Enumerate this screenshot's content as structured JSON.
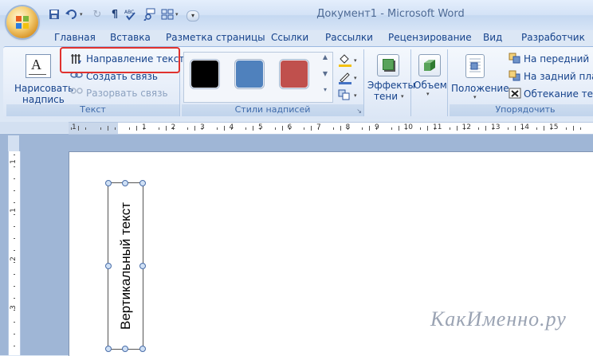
{
  "window": {
    "title": "Документ1 - Microsoft Word",
    "quick_access": [
      "save-icon",
      "undo-icon",
      "redo-icon",
      "pilcrow-icon",
      "spellcheck-icon",
      "zoom-icon",
      "layout-icon"
    ]
  },
  "tabs": [
    {
      "label": "Главная"
    },
    {
      "label": "Вставка"
    },
    {
      "label": "Разметка страницы"
    },
    {
      "label": "Ссылки"
    },
    {
      "label": "Рассылки"
    },
    {
      "label": "Рецензирование"
    },
    {
      "label": "Вид"
    },
    {
      "label": "Разработчик"
    }
  ],
  "ribbon": {
    "text_group": {
      "label": "Текст",
      "draw_textbox": [
        "Нарисовать",
        "надпись"
      ],
      "text_direction": "Направление текста",
      "create_link": "Создать связь",
      "break_link": "Разорвать связь"
    },
    "styles_group": {
      "label": "Стили надписей",
      "swatches": [
        "#000000",
        "#4f81bd",
        "#c0504d"
      ]
    },
    "effects": {
      "label": [
        "Эффекты",
        "тени"
      ]
    },
    "volume": {
      "label": "Объем"
    },
    "arrange_group": {
      "label": "Упорядочить",
      "position": "Положение",
      "bring_front": "На передний план",
      "send_back": "На задний план",
      "wrap_text": "Обтекание текст"
    }
  },
  "ruler": {
    "h_labels": [
      "1",
      "1",
      "2",
      "3",
      "4",
      "5",
      "6",
      "7",
      "8",
      "9",
      "10",
      "11",
      "12",
      "13",
      "14",
      "15"
    ],
    "v_labels": [
      "1",
      "1",
      "2",
      "3"
    ]
  },
  "document": {
    "textbox_text": "Вертикальный текст"
  },
  "watermark": "КакИменно.ру",
  "colors": {
    "highlight": "#e0322e",
    "ribbon_text": "#15428b"
  }
}
